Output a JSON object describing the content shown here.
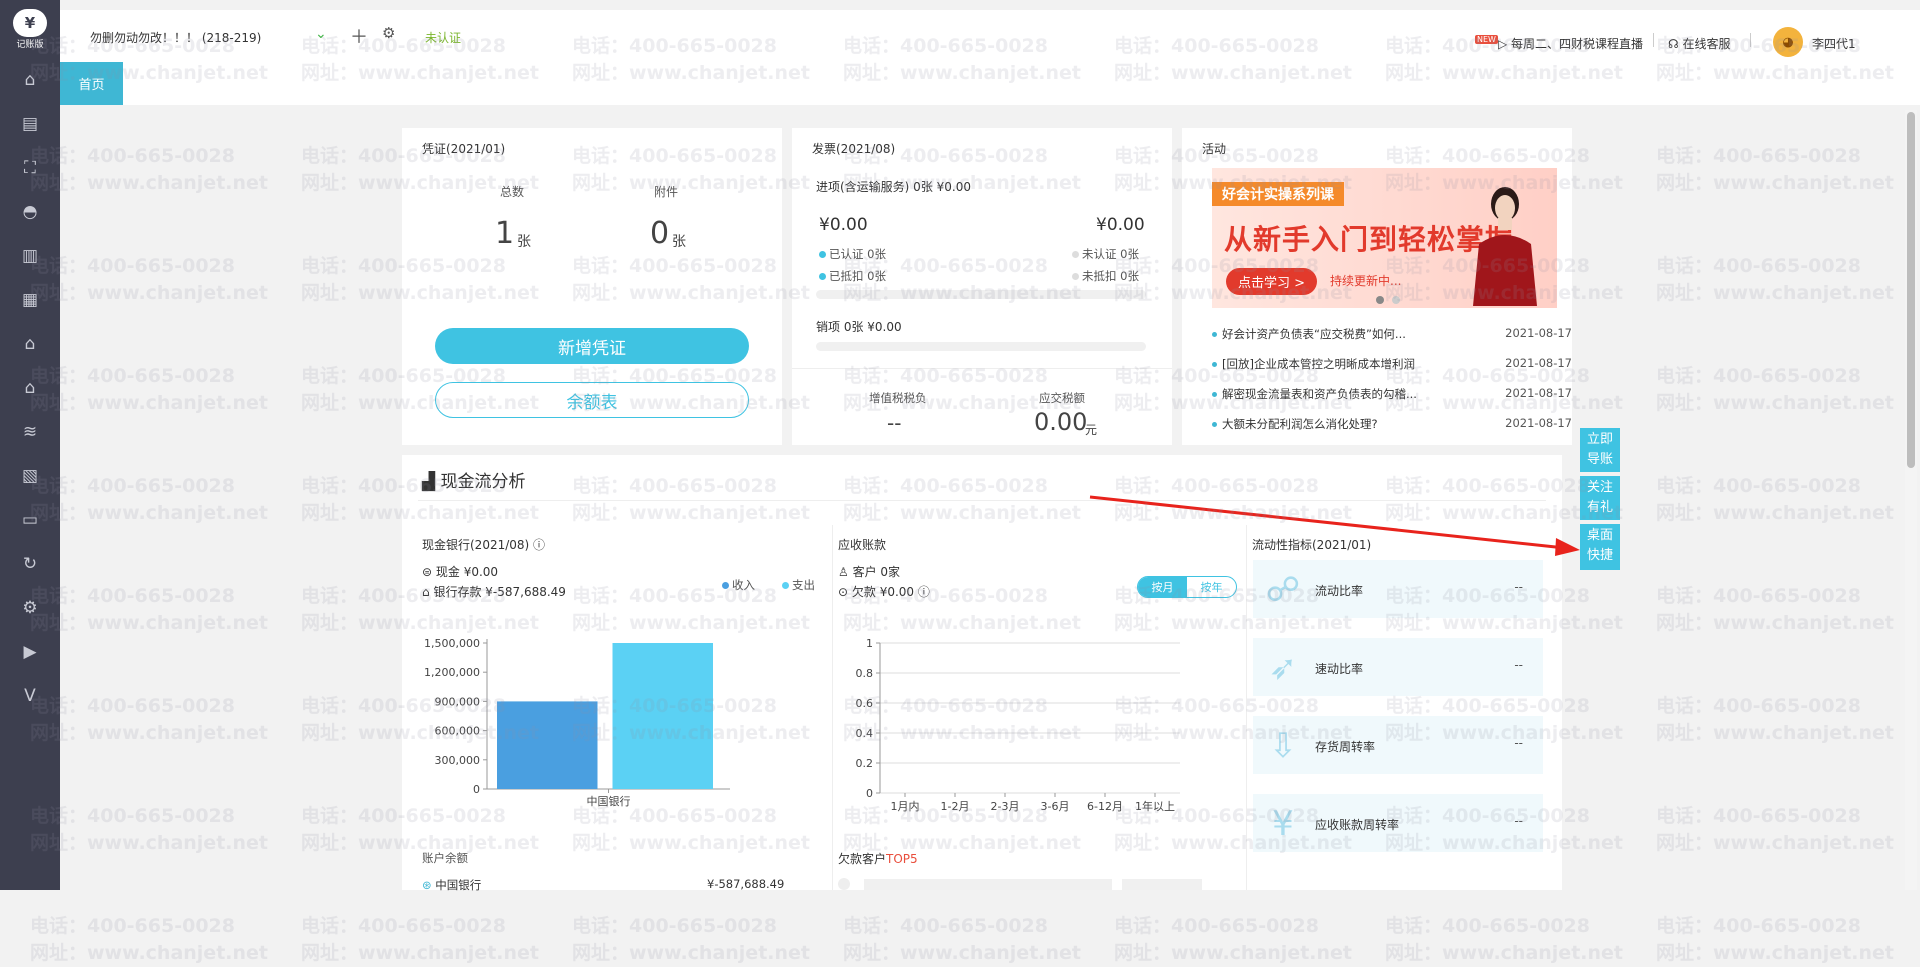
{
  "sidebar": {
    "logo_text": "记账版",
    "items": [
      {
        "name": "home-icon",
        "glyph": "⌂"
      },
      {
        "name": "voucher-icon",
        "glyph": "▤"
      },
      {
        "name": "report-chart-icon",
        "glyph": "⛶"
      },
      {
        "name": "money-bag-icon",
        "glyph": "◓"
      },
      {
        "name": "ledger-icon",
        "glyph": "▥"
      },
      {
        "name": "analysis-icon",
        "glyph": "▦"
      },
      {
        "name": "store-icon",
        "glyph": "⌂"
      },
      {
        "name": "bank-icon",
        "glyph": "⌂"
      },
      {
        "name": "coins-icon",
        "glyph": "≋"
      },
      {
        "name": "invoice-icon",
        "glyph": "▧"
      },
      {
        "name": "tax-icon",
        "glyph": "▭"
      },
      {
        "name": "refresh-icon",
        "glyph": "↻"
      },
      {
        "name": "settings-icon",
        "glyph": "⚙"
      },
      {
        "name": "video-icon",
        "glyph": "▶"
      },
      {
        "name": "vip-icon",
        "glyph": "V"
      }
    ]
  },
  "topbar": {
    "account": "勿删勿动勿改！！！  (218-219)",
    "unverified": "未认证",
    "live_badge": "NEW",
    "live_text": "每周二、四财税课程直播",
    "service_text": "在线客服",
    "user_name": "李四代1"
  },
  "tabs": {
    "home": "首页"
  },
  "voucher": {
    "title": "凭证(2021/01)",
    "total_label": "总数",
    "attach_label": "附件",
    "total_value": "1",
    "attach_value": "0",
    "unit": "张",
    "new_button": "新增凭证",
    "balance_button": "余额表"
  },
  "invoice": {
    "title": "发票(2021/08)",
    "input_line": "进项(含运输服务) 0张  ¥0.00",
    "left_amount": "¥0.00",
    "right_amount": "¥0.00",
    "certified": "已认证",
    "certified_count": "0张",
    "uncertified": "未认证",
    "uncertified_count": "0张",
    "deducted": "已抵扣",
    "deducted_count": "0张",
    "undeducted": "未抵扣",
    "undeducted_count": "0张",
    "output_line": "销项     0张     ¥0.00",
    "vat_burden_label": "增值税税负",
    "vat_burden_value": "--",
    "tax_payable_label": "应交税额",
    "tax_payable_value": "0.00",
    "tax_payable_unit": "元",
    "colors": {
      "certified": "#3fc3e2",
      "uncertified": "#dddddd"
    }
  },
  "activity": {
    "title": "活动",
    "banner_tag": "好会计实操系列课",
    "banner_headline": "从新手入门到轻松掌握",
    "banner_button": "点击学习 >",
    "banner_sub": "持续更新中...",
    "news": [
      {
        "title": "好会计资产负债表“应交税费”如何...",
        "date": "2021-08-17"
      },
      {
        "title": "[回放]企业成本管控之明晰成本增利润",
        "date": "2021-08-17"
      },
      {
        "title": "解密现金流量表和资产负债表的勾稽...",
        "date": "2021-08-17"
      },
      {
        "title": "大额未分配利润怎么消化处理?",
        "date": "2021-08-17"
      }
    ]
  },
  "floating": {
    "import": "立即导账",
    "follow": "关注有礼",
    "desktop": "桌面快捷"
  },
  "cashflow": {
    "title": "现金流分析",
    "bank_title": "现金银行(2021/08)",
    "cash_line": "现金  ¥0.00",
    "deposit_line": "银行存款  ¥-587,688.49",
    "legend_income": "收入",
    "legend_expense": "支出",
    "account_balance_label": "账户余额",
    "bank_name": "中国银行",
    "bank_balance": "¥-587,688.49",
    "receivable_title": "应收账款",
    "customers_line": "客户  0家",
    "arrears_line": "欠款  ¥0.00",
    "toggle_month": "按月",
    "toggle_year": "按年",
    "top5_label": "欠款客户",
    "top5_highlight": "TOP5",
    "liquidity_title": "流动性指标(2021/01)",
    "metrics": [
      {
        "label": "流动比率",
        "value": "--",
        "icon": "fluid-icon"
      },
      {
        "label": "速动比率",
        "value": "--",
        "icon": "rocket-icon"
      },
      {
        "label": "存货周转率",
        "value": "--",
        "icon": "inventory-icon"
      },
      {
        "label": "应收账款周转率",
        "value": "--",
        "icon": "receivable-icon"
      }
    ]
  },
  "watermark": {
    "phone": "电话：400-665-0028",
    "site": "网址：www.chanjet.net"
  },
  "chart_data": [
    {
      "type": "bar",
      "categories": [
        "中国银行"
      ],
      "series": [
        {
          "name": "收入",
          "values": [
            900000
          ],
          "color": "#4a9fe0"
        },
        {
          "name": "支出",
          "values": [
            1500000
          ],
          "color": "#5bd1f4"
        }
      ],
      "ylim": [
        0,
        1500000
      ],
      "yticks": [
        "0",
        "300,000",
        "600,000",
        "900,000",
        "1,200,000",
        "1,500,000"
      ],
      "legend_position": "top-right"
    },
    {
      "type": "line",
      "categories": [
        "1月内",
        "1-2月",
        "2-3月",
        "3-6月",
        "6-12月",
        "1年以上"
      ],
      "series": [],
      "ylim": [
        0,
        1
      ],
      "yticks": [
        "0",
        "0.2",
        "0.4",
        "0.6",
        "0.8",
        "1"
      ]
    }
  ]
}
